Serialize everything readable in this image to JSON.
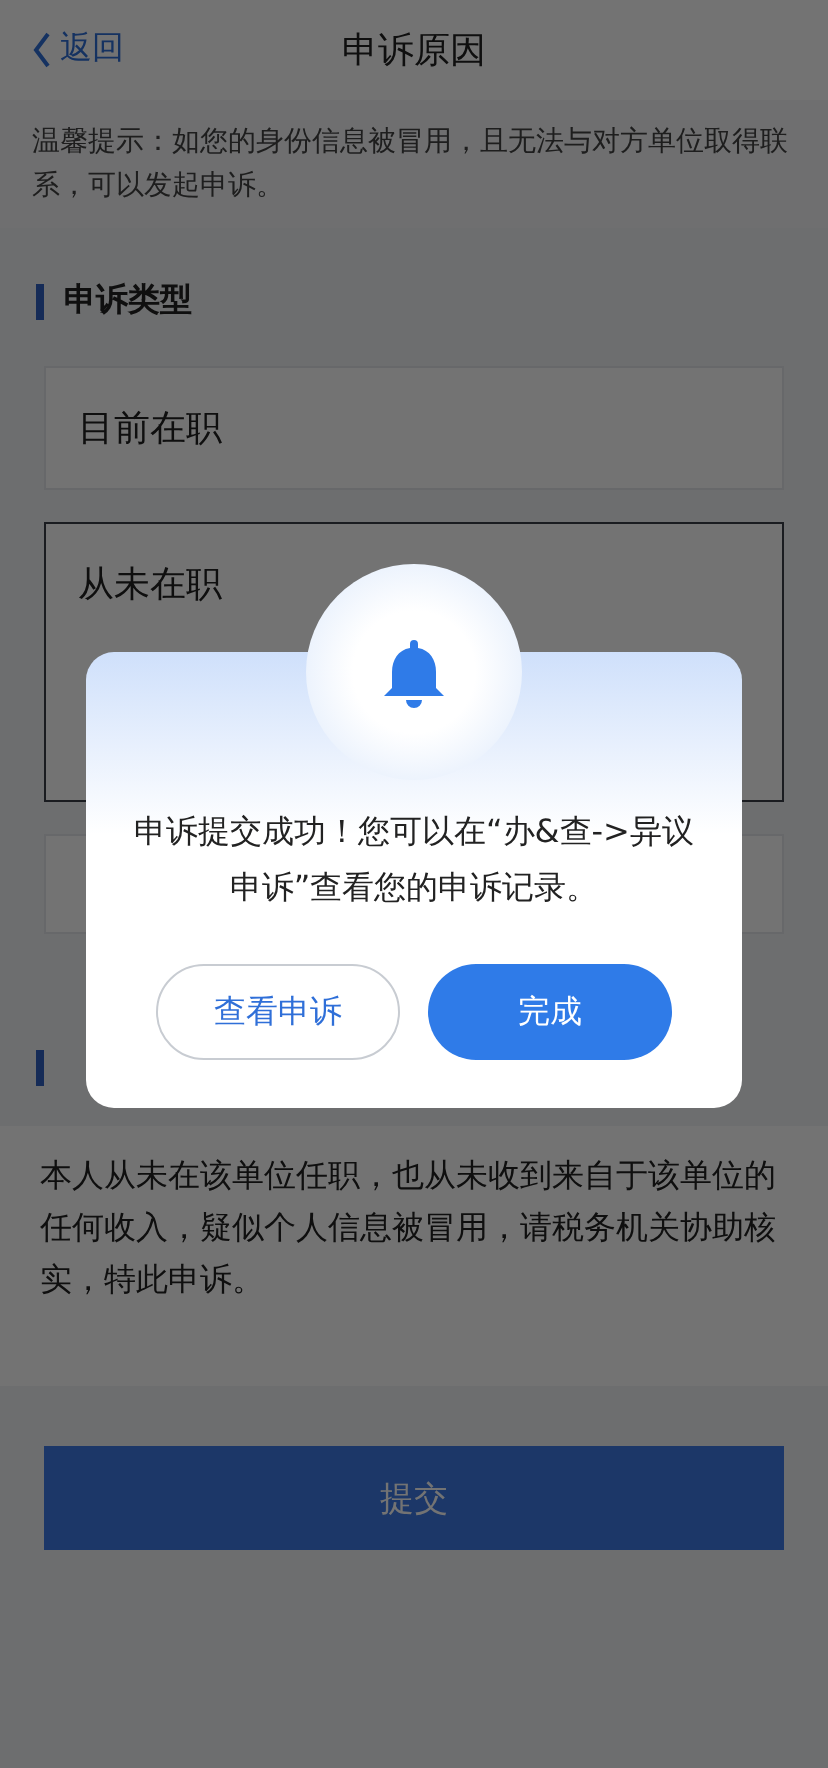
{
  "nav": {
    "back": "返回",
    "title": "申诉原因"
  },
  "tip": "温馨提示：如您的身份信息被冒用，且无法与对方单位取得联系，可以发起申诉。",
  "section": {
    "title": "申诉类型"
  },
  "options": [
    {
      "label": "目前在职",
      "selected": false
    },
    {
      "label": "从未在职",
      "selected": true
    }
  ],
  "description": "本人从未在该单位任职，也从未收到来自于该单位的任何收入，疑似个人信息被冒用，请税务机关协助核实，特此申诉。",
  "submit": "提交",
  "dialog": {
    "message": "申诉提交成功！您可以在“办&查->异议申诉”查看您的申诉记录。",
    "buttons": [
      {
        "label": "查看申诉",
        "kind": "secondary"
      },
      {
        "label": "完成",
        "kind": "primary"
      }
    ]
  }
}
